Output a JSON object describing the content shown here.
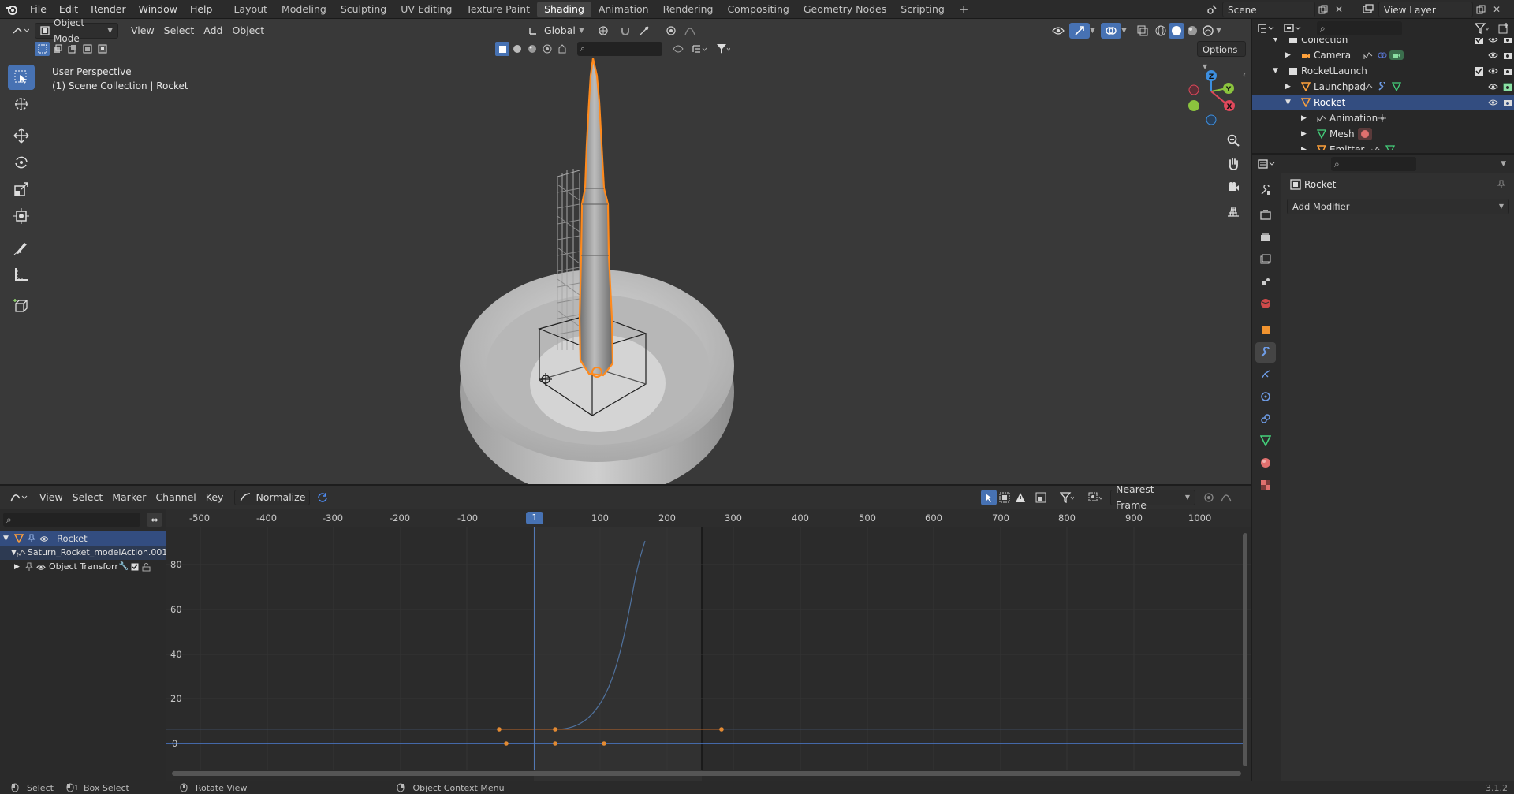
{
  "topbar": {
    "menu": [
      "File",
      "Edit",
      "Render",
      "Window",
      "Help"
    ],
    "workspaces": [
      "Layout",
      "Modeling",
      "Sculpting",
      "UV Editing",
      "Texture Paint",
      "Shading",
      "Animation",
      "Rendering",
      "Compositing",
      "Geometry Nodes",
      "Scripting"
    ],
    "active_workspace": "Shading",
    "scene_label": "Scene",
    "view_layer_label": "View Layer"
  },
  "viewport": {
    "mode": "Object Mode",
    "menus": [
      "View",
      "Select",
      "Add",
      "Object"
    ],
    "transform_orientation": "Global",
    "options_label": "Options",
    "overlay_line1": "User Perspective",
    "overlay_line2": "(1) Scene Collection | Rocket",
    "gizmo_axes": {
      "z": "Z",
      "y": "Y",
      "x": "X"
    }
  },
  "graph_editor": {
    "menus": [
      "View",
      "Select",
      "Marker",
      "Channel",
      "Key"
    ],
    "normalize_label": "Normalize",
    "snap_mode": "Nearest Frame",
    "current_frame": "1",
    "x_ticks": [
      "-500",
      "-400",
      "-300",
      "-200",
      "-100",
      "100",
      "200",
      "300",
      "400",
      "500",
      "600",
      "700",
      "800",
      "900",
      "1000"
    ],
    "y_ticks": [
      "80",
      "60",
      "40",
      "20",
      "0"
    ],
    "channels": [
      {
        "label": "Rocket"
      },
      {
        "label": "Saturn_Rocket_modelAction.001"
      },
      {
        "label": "Object Transform"
      }
    ]
  },
  "outliner": {
    "rows": [
      {
        "label": "Collection"
      },
      {
        "label": "Camera"
      },
      {
        "label": "RocketLaunch"
      },
      {
        "label": "Launchpad"
      },
      {
        "label": "Rocket"
      },
      {
        "label": "Animation"
      },
      {
        "label": "Mesh"
      },
      {
        "label": "Emitter"
      }
    ]
  },
  "properties": {
    "object_name": "Rocket",
    "add_modifier_label": "Add Modifier"
  },
  "statusbar": {
    "items": [
      "Select",
      "Box Select",
      "Rotate View",
      "Object Context Menu"
    ],
    "version": "3.1.2"
  },
  "colors": {
    "accent_blue": "#4772b3",
    "selection_orange": "#ff8a1d",
    "outliner_selected": "#334d80",
    "axis_x": "#e0485b",
    "axis_y": "#8bc43e",
    "axis_z": "#3d8fe0"
  }
}
